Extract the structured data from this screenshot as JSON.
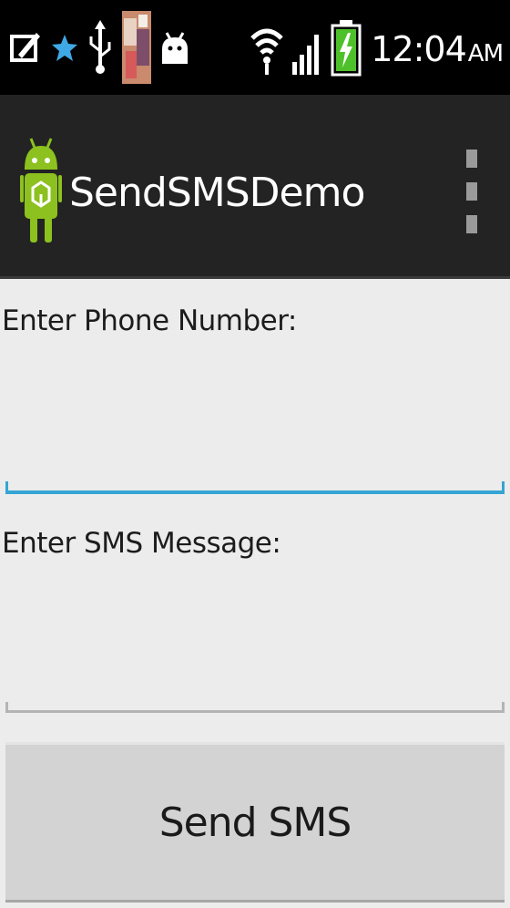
{
  "status_bar": {
    "icons": [
      "edit-icon",
      "star-icon",
      "usb-icon",
      "photo-thumbnail-icon",
      "android-bug-icon",
      "wifi-icon",
      "signal-icon",
      "battery-charging-icon"
    ],
    "time": "12:04",
    "ampm": "AM",
    "colors": {
      "star": "#3fa9e6",
      "battery": "#4ec02a"
    }
  },
  "action_bar": {
    "title": "SendSMSDemo",
    "icons": [
      "android-app-icon",
      "overflow-menu-icon"
    ],
    "colors": {
      "background": "#232323",
      "android_green": "#8cc11f"
    }
  },
  "form": {
    "phone_label": "Enter Phone Number:",
    "phone_value": "",
    "message_label": "Enter SMS Message:",
    "message_value": "",
    "send_label": "Send SMS",
    "colors": {
      "focused_underline": "#35a5d4",
      "underline": "#b4b4b4"
    }
  }
}
